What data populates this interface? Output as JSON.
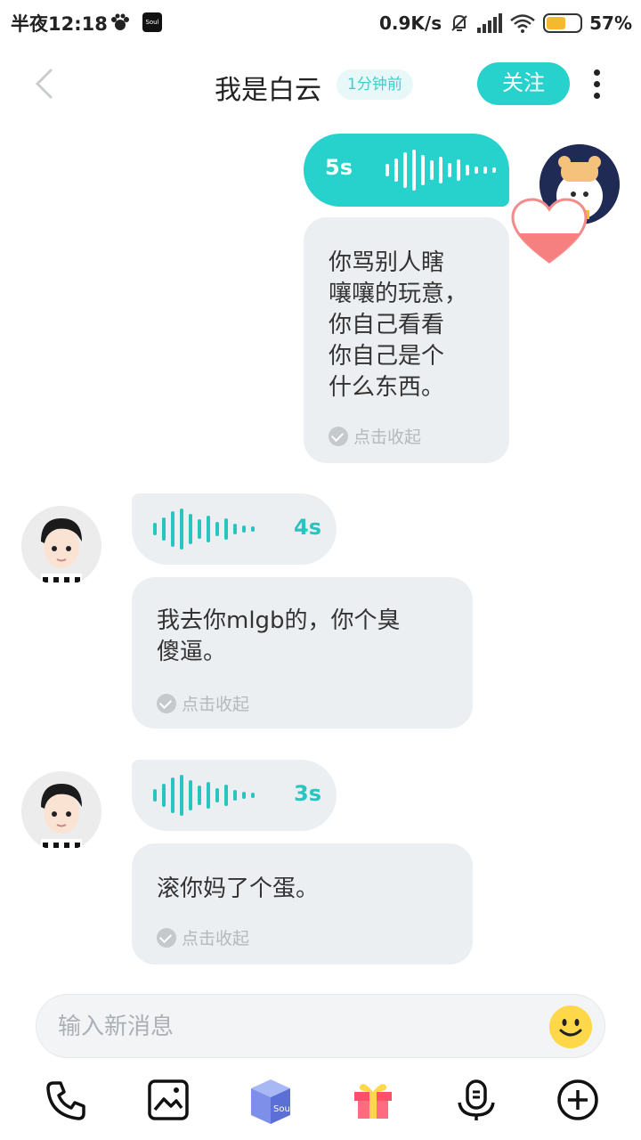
{
  "status_bar": {
    "time": "半夜12:18",
    "network_speed": "0.9K/s",
    "battery_percent": "57%",
    "battery_level": 0.57
  },
  "header": {
    "title": "我是白云",
    "time_badge": "1分钟前",
    "follow_label": "关注"
  },
  "messages": [
    {
      "sender": "self",
      "voice_duration": "5s",
      "text": [
        "你骂别人瞎",
        "嚷嚷的玩意，",
        "你自己看看",
        "你自己是个",
        "什么东西。"
      ],
      "collapse_label": "点击收起"
    },
    {
      "sender": "other",
      "voice_duration": "4s",
      "text": [
        "我去你mlgb的，你个臭",
        "傻逼。"
      ],
      "collapse_label": "点击收起"
    },
    {
      "sender": "other",
      "voice_duration": "3s",
      "text": [
        "滚你妈了个蛋。"
      ],
      "collapse_label": "点击收起"
    }
  ],
  "input": {
    "placeholder": "输入新消息"
  },
  "toolbar": {
    "items": [
      "phone-icon",
      "image-icon",
      "soul-box-icon",
      "gift-icon",
      "voice-icon",
      "plus-icon"
    ],
    "soul_label": "Soul"
  },
  "colors": {
    "accent": "#27d1cc",
    "bubble_gray": "#eceff1"
  }
}
